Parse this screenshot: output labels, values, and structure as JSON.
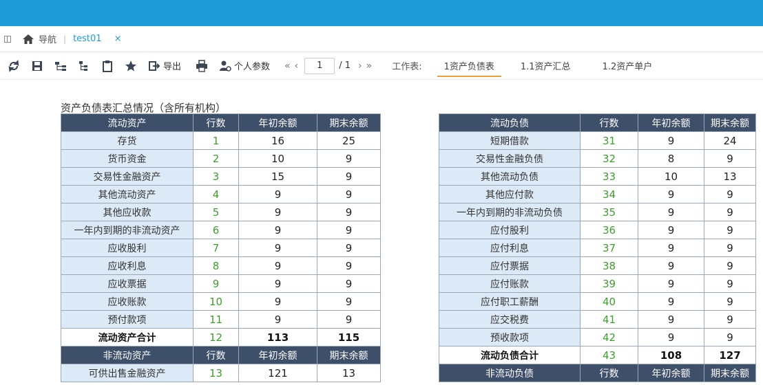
{
  "tabbar": {
    "home_label": "导航",
    "sep": "|",
    "tab_label": "test01",
    "close": "×"
  },
  "toolbar": {
    "export_label": "导出",
    "personal_params_label": "个人参数",
    "page_current": "1",
    "page_total": "/ 1",
    "worksheet_label": "工作表:",
    "worksheets": [
      "1资产负债表",
      "1.1资产汇总",
      "1.2资产单户"
    ],
    "active_worksheet": 0
  },
  "report": {
    "title": "资产负债表汇总情况（含所有机构）",
    "headers": {
      "rownum": "行数",
      "begin": "年初余额",
      "end": "期末余额"
    },
    "left": {
      "section1": "流动资产",
      "rows": [
        {
          "name": "存货",
          "row": "1",
          "begin": "16",
          "end": "25"
        },
        {
          "name": "货币资金",
          "row": "2",
          "begin": "10",
          "end": "9"
        },
        {
          "name": "交易性金融资产",
          "row": "3",
          "begin": "15",
          "end": "9"
        },
        {
          "name": "其他流动资产",
          "row": "4",
          "begin": "9",
          "end": "9"
        },
        {
          "name": "其他应收款",
          "row": "5",
          "begin": "9",
          "end": "9"
        },
        {
          "name": "一年内到期的非流动资产",
          "row": "6",
          "begin": "9",
          "end": "9"
        },
        {
          "name": "应收股利",
          "row": "7",
          "begin": "9",
          "end": "9"
        },
        {
          "name": "应收利息",
          "row": "8",
          "begin": "9",
          "end": "9"
        },
        {
          "name": "应收票据",
          "row": "9",
          "begin": "9",
          "end": "9"
        },
        {
          "name": "应收账款",
          "row": "10",
          "begin": "9",
          "end": "9"
        },
        {
          "name": "预付款项",
          "row": "11",
          "begin": "9",
          "end": "9"
        }
      ],
      "total": {
        "name": "流动资产合计",
        "row": "12",
        "begin": "113",
        "end": "115"
      },
      "section2": "非流动资产",
      "rows2": [
        {
          "name": "可供出售金融资产",
          "row": "13",
          "begin": "121",
          "end": "13"
        }
      ]
    },
    "right": {
      "section1": "流动负债",
      "rows": [
        {
          "name": "短期借款",
          "row": "31",
          "begin": "9",
          "end": "24"
        },
        {
          "name": "交易性金融负债",
          "row": "32",
          "begin": "8",
          "end": "9"
        },
        {
          "name": "其他流动负债",
          "row": "33",
          "begin": "10",
          "end": "13"
        },
        {
          "name": "其他应付款",
          "row": "34",
          "begin": "9",
          "end": "9"
        },
        {
          "name": "一年内到期的非流动负债",
          "row": "35",
          "begin": "9",
          "end": "9"
        },
        {
          "name": "应付股利",
          "row": "36",
          "begin": "9",
          "end": "9"
        },
        {
          "name": "应付利息",
          "row": "37",
          "begin": "9",
          "end": "9"
        },
        {
          "name": "应付票据",
          "row": "38",
          "begin": "9",
          "end": "9"
        },
        {
          "name": "应付账款",
          "row": "39",
          "begin": "9",
          "end": "9"
        },
        {
          "name": "应付职工薪酬",
          "row": "40",
          "begin": "9",
          "end": "9"
        },
        {
          "name": "应交税费",
          "row": "41",
          "begin": "9",
          "end": "9"
        },
        {
          "name": "预收款项",
          "row": "42",
          "begin": "9",
          "end": "9"
        }
      ],
      "total": {
        "name": "流动负债合计",
        "row": "43",
        "begin": "108",
        "end": "127"
      },
      "section2": "非流动负债"
    }
  }
}
